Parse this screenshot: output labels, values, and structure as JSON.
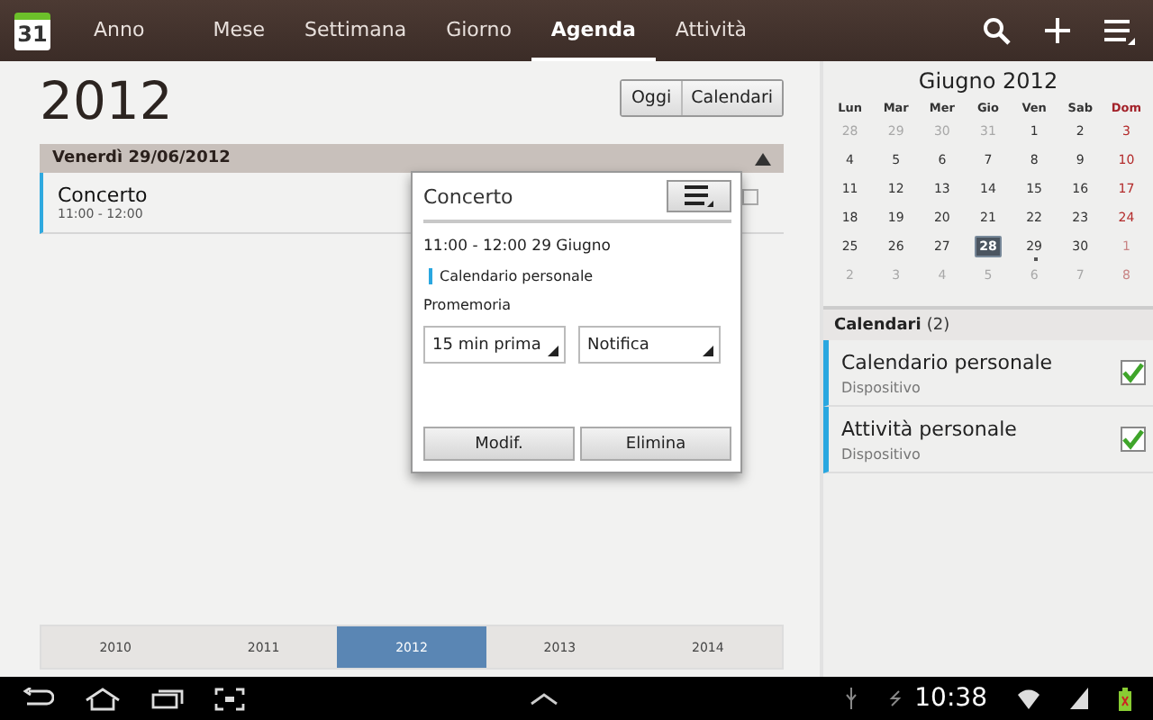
{
  "top_bar": {
    "app_icon_day": "31",
    "tabs": [
      {
        "label": "Anno",
        "selected": false
      },
      {
        "label": "Mese",
        "selected": false
      },
      {
        "label": "Settimana",
        "selected": false
      },
      {
        "label": "Giorno",
        "selected": false
      },
      {
        "label": "Agenda",
        "selected": true
      },
      {
        "label": "Attività",
        "selected": false
      }
    ]
  },
  "year_title": "2012",
  "header_buttons": [
    "Oggi",
    "Calendari"
  ],
  "agenda": {
    "date_header": "Venerdì 29/06/2012",
    "events": [
      {
        "title": "Concerto",
        "time": "11:00 - 12:00"
      }
    ]
  },
  "popup": {
    "title": "Concerto",
    "datetime": "11:00 - 12:00 29 Giugno",
    "calendar": "Calendario personale",
    "reminder_label": "Promemoria",
    "dropdowns": [
      "15 min prima",
      "Notifica"
    ],
    "buttons": [
      "Modif.",
      "Elimina"
    ]
  },
  "mini_calendar": {
    "title": "Giugno 2012",
    "weekdays": [
      "Lun",
      "Mar",
      "Mer",
      "Gio",
      "Ven",
      "Sab",
      "Dom"
    ],
    "weeks": [
      [
        {
          "day": "28",
          "muted": true,
          "selected": false,
          "event": false
        },
        {
          "day": "29",
          "muted": true,
          "selected": false,
          "event": false
        },
        {
          "day": "30",
          "muted": true,
          "selected": false,
          "event": false
        },
        {
          "day": "31",
          "muted": true,
          "selected": false,
          "event": false
        },
        {
          "day": "1",
          "muted": false,
          "selected": false,
          "event": false
        },
        {
          "day": "2",
          "muted": false,
          "selected": false,
          "event": false
        },
        {
          "day": "3",
          "muted": false,
          "selected": false,
          "event": false
        }
      ],
      [
        {
          "day": "4",
          "muted": false,
          "selected": false,
          "event": false
        },
        {
          "day": "5",
          "muted": false,
          "selected": false,
          "event": false
        },
        {
          "day": "6",
          "muted": false,
          "selected": false,
          "event": false
        },
        {
          "day": "7",
          "muted": false,
          "selected": false,
          "event": false
        },
        {
          "day": "8",
          "muted": false,
          "selected": false,
          "event": false
        },
        {
          "day": "9",
          "muted": false,
          "selected": false,
          "event": false
        },
        {
          "day": "10",
          "muted": false,
          "selected": false,
          "event": false
        }
      ],
      [
        {
          "day": "11",
          "muted": false,
          "selected": false,
          "event": false
        },
        {
          "day": "12",
          "muted": false,
          "selected": false,
          "event": false
        },
        {
          "day": "13",
          "muted": false,
          "selected": false,
          "event": false
        },
        {
          "day": "14",
          "muted": false,
          "selected": false,
          "event": false
        },
        {
          "day": "15",
          "muted": false,
          "selected": false,
          "event": false
        },
        {
          "day": "16",
          "muted": false,
          "selected": false,
          "event": false
        },
        {
          "day": "17",
          "muted": false,
          "selected": false,
          "event": false
        }
      ],
      [
        {
          "day": "18",
          "muted": false,
          "selected": false,
          "event": false
        },
        {
          "day": "19",
          "muted": false,
          "selected": false,
          "event": false
        },
        {
          "day": "20",
          "muted": false,
          "selected": false,
          "event": false
        },
        {
          "day": "21",
          "muted": false,
          "selected": false,
          "event": false
        },
        {
          "day": "22",
          "muted": false,
          "selected": false,
          "event": false
        },
        {
          "day": "23",
          "muted": false,
          "selected": false,
          "event": false
        },
        {
          "day": "24",
          "muted": false,
          "selected": false,
          "event": false
        }
      ],
      [
        {
          "day": "25",
          "muted": false,
          "selected": false,
          "event": false
        },
        {
          "day": "26",
          "muted": false,
          "selected": false,
          "event": false
        },
        {
          "day": "27",
          "muted": false,
          "selected": false,
          "event": false
        },
        {
          "day": "28",
          "muted": false,
          "selected": true,
          "event": false
        },
        {
          "day": "29",
          "muted": false,
          "selected": false,
          "event": true
        },
        {
          "day": "30",
          "muted": false,
          "selected": false,
          "event": false
        },
        {
          "day": "1",
          "muted": true,
          "selected": false,
          "event": false
        }
      ],
      [
        {
          "day": "2",
          "muted": true,
          "selected": false,
          "event": false
        },
        {
          "day": "3",
          "muted": true,
          "selected": false,
          "event": false
        },
        {
          "day": "4",
          "muted": true,
          "selected": false,
          "event": false
        },
        {
          "day": "5",
          "muted": true,
          "selected": false,
          "event": false
        },
        {
          "day": "6",
          "muted": true,
          "selected": false,
          "event": false
        },
        {
          "day": "7",
          "muted": true,
          "selected": false,
          "event": false
        },
        {
          "day": "8",
          "muted": true,
          "selected": false,
          "event": false
        }
      ]
    ]
  },
  "calendars": {
    "title": "Calendari",
    "count": "(2)",
    "items": [
      {
        "name": "Calendario personale",
        "account": "Dispositivo",
        "checked": true
      },
      {
        "name": "Attività personale",
        "account": "Dispositivo",
        "checked": true
      }
    ]
  },
  "year_strip": [
    {
      "label": "2010",
      "selected": false
    },
    {
      "label": "2011",
      "selected": false
    },
    {
      "label": "2012",
      "selected": true
    },
    {
      "label": "2013",
      "selected": false
    },
    {
      "label": "2014",
      "selected": false
    }
  ],
  "status_bar": {
    "time": "10:38"
  }
}
